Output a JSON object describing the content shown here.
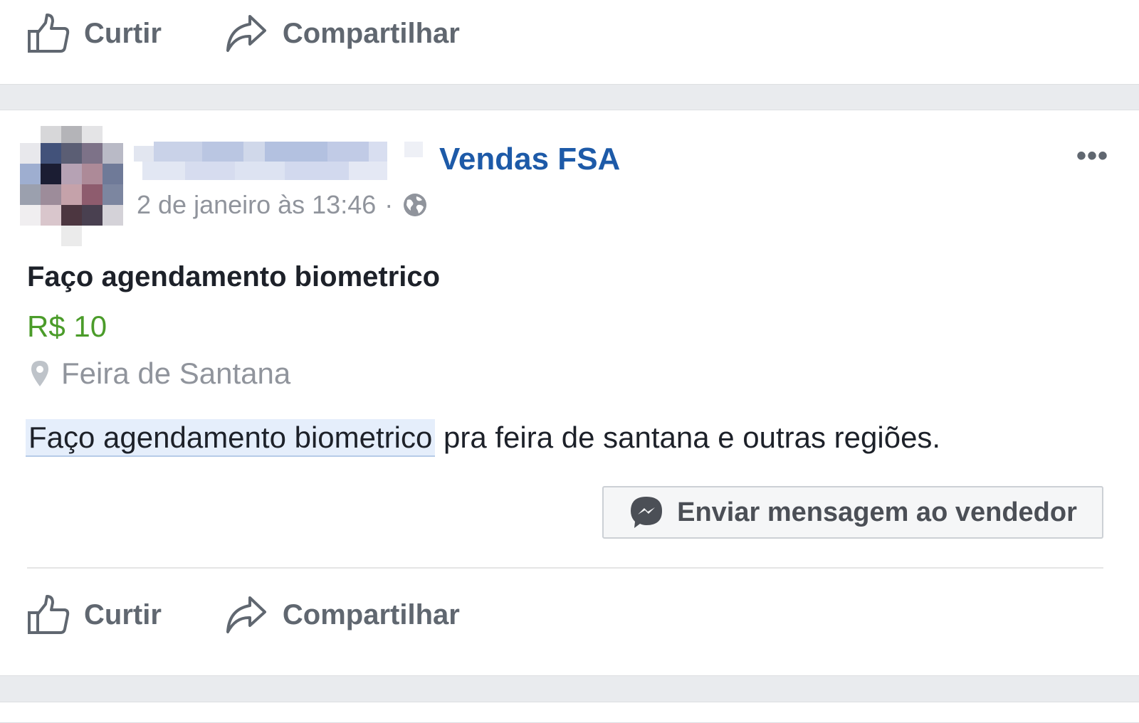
{
  "top_actions": {
    "like_label": "Curtir",
    "share_label": "Compartilhar"
  },
  "post": {
    "group_name": "Vendas FSA",
    "timestamp": "2 de janeiro às 13:46",
    "timestamp_separator": "·",
    "more_label": "•••",
    "title": "Faço agendamento biometrico",
    "price": "R$ 10",
    "location": "Feira de Santana",
    "description_highlight": "Faço agendamento biometrico",
    "description_rest": " pra feira de santana e outras regiões.",
    "message_button": "Enviar mensagem ao vendedor",
    "actions": {
      "like_label": "Curtir",
      "share_label": "Compartilhar"
    }
  },
  "icons": {
    "like": "thumbs-up-icon",
    "share": "share-arrow-icon",
    "privacy": "globe-icon",
    "location": "map-pin-icon",
    "messenger": "messenger-icon"
  },
  "colors": {
    "background": "#e9ebee",
    "card": "#ffffff",
    "link_blue": "#1d5aa8",
    "price_green": "#4b9c2a",
    "muted_gray": "#90949c",
    "action_gray": "#606770",
    "highlight": "#e5eefb"
  }
}
